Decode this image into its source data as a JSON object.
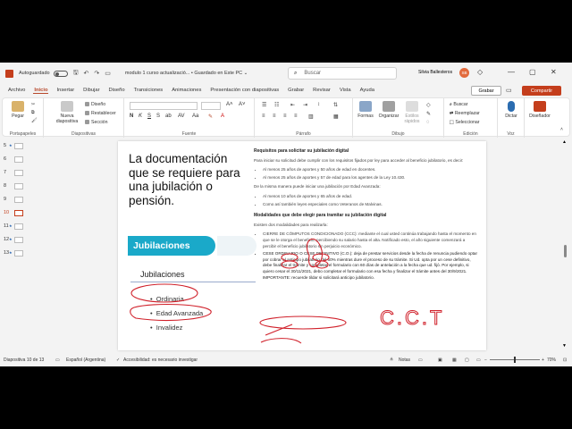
{
  "titlebar": {
    "autosave": "Autoguardado",
    "doc_name": "modulo 1 curso actualizació... • Guardado en Este PC ⌄",
    "search_placeholder": "Buscar",
    "user": "Silvia Ballesteros",
    "avatar": "SB"
  },
  "menu": {
    "tabs": [
      "Archivo",
      "Inicio",
      "Insertar",
      "Dibujar",
      "Diseño",
      "Transiciones",
      "Animaciones",
      "Presentación con diapositivas",
      "Grabar",
      "Revisar",
      "Vista",
      "Ayuda"
    ],
    "active": "Inicio",
    "grabar": "Grabar",
    "compartir": "Compartir"
  },
  "ribbon": {
    "groups": [
      "Portapapeles",
      "Diapositivas",
      "Fuente",
      "Párrafo",
      "Dibujo",
      "Edición",
      "Voz"
    ],
    "pegar": "Pegar",
    "nueva": "Nueva diapositiva",
    "diseno": "Diseño",
    "restablecer": "Restablecer",
    "seccion": "Sección",
    "formas": "Formas",
    "organizar": "Organizar",
    "estilos": "Estilos rápidos",
    "buscar": "Buscar",
    "reemplazar": "Reemplazar",
    "seleccionar": "Seleccionar",
    "dictar": "Dictar",
    "disenador": "Diseñador"
  },
  "thumbnails": [
    "5",
    "6",
    "7",
    "8",
    "9",
    "10",
    "11",
    "12",
    "13"
  ],
  "active_thumb": "10",
  "slide": {
    "title": "La documentación que se requiere para una jubilación o pensión.",
    "banner": "Jubilaciones",
    "list_title": "Jubilaciones",
    "items": [
      "Ordinaria",
      "Edad Avanzada",
      "Invalidez"
    ],
    "right": {
      "h1": "Requisitos para solicitar su jubilación digital",
      "p1": "Para iniciar su solicitud debe cumplir con los requisitos fijados por ley para acceder al beneficio jubilatorio, es decir:",
      "b1": "Al menos 25 años de aportes y 50 años de edad en docentes.",
      "b2": "Al menos 25 años de aportes y 57 de edad para los agentes de la Ley 10.430.",
      "p2": "De la misma manera puede iniciar una jubilación por Edad Avanzada:",
      "b3": "Al menos 10 años de aportes y 65 años de edad.",
      "b4": "Como así también leyes especiales como Veteranos de Malvinas.",
      "h2": "Modalidades que debe elegir para tramitar su jubilación digital",
      "p3": "Existen dos modalidades para realizarla:",
      "b5": "CIERRE DE CÓMPUTOS CONDICIONADO (CCC): mediante el cual usted continúa trabajando hasta el momento en que se le otorga el beneficio, percibiendo su salario hasta el alta. Notificado esto, el año siguiente comenzará a percibir el beneficio jubilatorio sin perjuicio económico.",
      "b6": "CESE ORDINARIO O CESE DEFINITIVO (C.O.): deja de prestar servicios desde la fecha de renuncia pudiendo optar por cobrar el anticipo jubilatorio del 60% mientras dure el proceso de su trámite. Si Ud. opta por un cese definitivo, debe finalizar el trámite y completar el formulario con 60 días de antelación a la fecha que ud. fijó. Por ejemplo, si quiero cesar el 30/11/2021, debo completar el formulario con esa fecha y finalizar el trámite antes del 30/9/2021. IMPORTANTE: recuerde tildar si solicitará anticipo jubilatorio."
    },
    "annotation": "C.C.T"
  },
  "status": {
    "slide": "Diapositiva 10 de 13",
    "lang": "Español (Argentina)",
    "access": "Accesibilidad: es necesario investigar",
    "notes": "Notas",
    "zoom": "70%"
  },
  "colors": {
    "accent": "#c43e1c",
    "banner": "#1aa9c9",
    "ink": "#d0202a"
  }
}
